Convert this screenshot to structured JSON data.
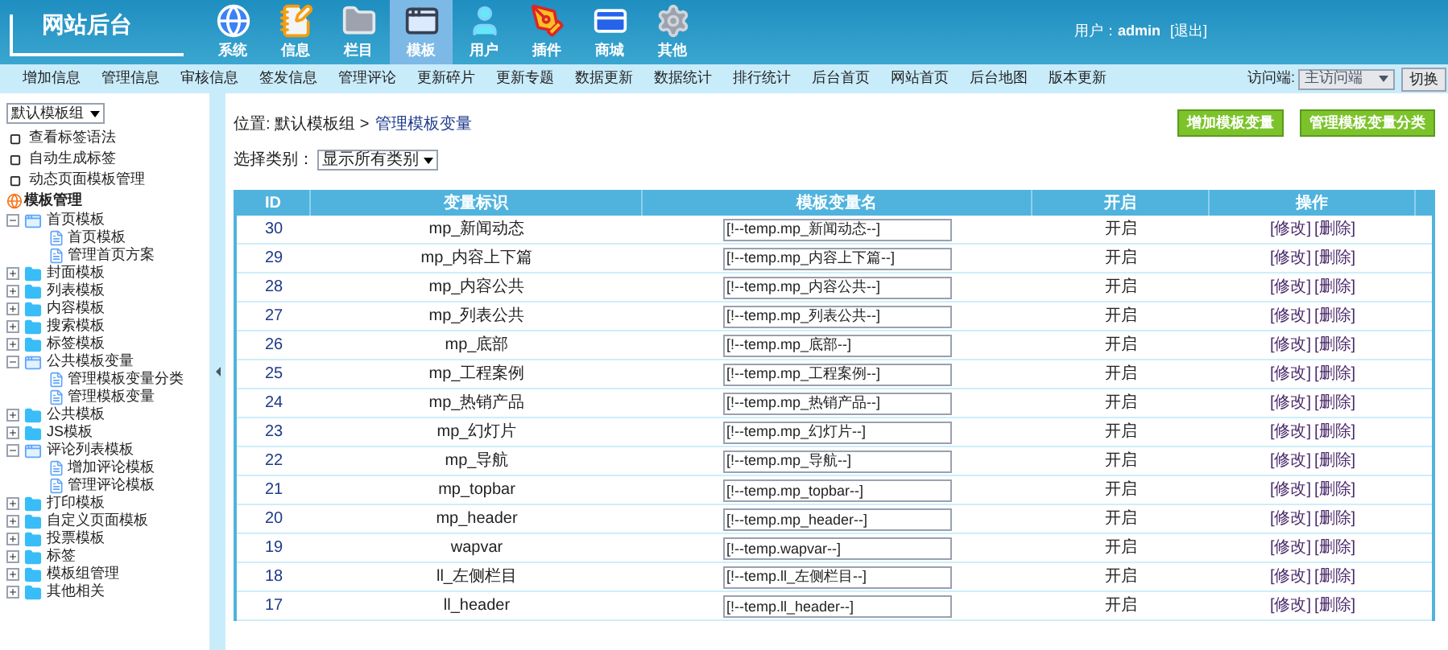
{
  "header": {
    "logo_text": "网站后台",
    "modules": [
      {
        "label": "系统",
        "kind": "globe",
        "selected": false
      },
      {
        "label": "信息",
        "kind": "note",
        "selected": false
      },
      {
        "label": "栏目",
        "kind": "folder",
        "selected": false
      },
      {
        "label": "模板",
        "kind": "window",
        "selected": true
      },
      {
        "label": "用户",
        "kind": "user",
        "selected": false
      },
      {
        "label": "插件",
        "kind": "tools",
        "selected": false
      },
      {
        "label": "商城",
        "kind": "card",
        "selected": false
      },
      {
        "label": "其他",
        "kind": "gear",
        "selected": false
      }
    ],
    "user_label": "用户：",
    "user": "admin",
    "logout": "[退出]"
  },
  "nav": {
    "items": [
      "增加信息",
      "管理信息",
      "审核信息",
      "签发信息",
      "管理评论",
      "更新碎片",
      "更新专题",
      "数据更新",
      "数据统计",
      "排行统计",
      "后台首页",
      "网站首页",
      "后台地图",
      "版本更新"
    ],
    "visit_label": "访问端:",
    "visit_select": "主访问端",
    "switch_button": "切换"
  },
  "sidebar": {
    "group_select": "默认模板组",
    "links": [
      "查看标签语法",
      "自动生成标签",
      "动态页面模板管理"
    ],
    "tree_title": "模板管理",
    "tree": [
      {
        "label": "首页模板",
        "expanded": true,
        "children": [
          {
            "label": "首页模板"
          },
          {
            "label": "管理首页方案"
          }
        ]
      },
      {
        "label": "封面模板",
        "expanded": false
      },
      {
        "label": "列表模板",
        "expanded": false
      },
      {
        "label": "内容模板",
        "expanded": false
      },
      {
        "label": "搜索模板",
        "expanded": false
      },
      {
        "label": "标签模板",
        "expanded": false
      },
      {
        "label": "公共模板变量",
        "expanded": true,
        "children": [
          {
            "label": "管理模板变量分类"
          },
          {
            "label": "管理模板变量"
          }
        ]
      },
      {
        "label": "公共模板",
        "expanded": false
      },
      {
        "label": "JS模板",
        "expanded": false
      },
      {
        "label": "评论列表模板",
        "expanded": true,
        "children": [
          {
            "label": "增加评论模板"
          },
          {
            "label": "管理评论模板"
          }
        ]
      },
      {
        "label": "打印模板",
        "expanded": false
      },
      {
        "label": "自定义页面模板",
        "expanded": false
      },
      {
        "label": "投票模板",
        "expanded": false
      },
      {
        "label": "标签",
        "expanded": false
      },
      {
        "label": "模板组管理",
        "expanded": false
      },
      {
        "label": "其他相关",
        "expanded": false
      }
    ]
  },
  "content": {
    "breadcrumb": "位置: 默认模板组 >",
    "breadcrumb_link": "管理模板变量",
    "buttons": [
      "增加模板变量",
      "管理模板变量分类"
    ],
    "filter_label": "选择类别：",
    "filter_select": "显示所有类别",
    "table": {
      "columns": [
        "ID",
        "变量标识",
        "模板变量名",
        "开启",
        "操作"
      ],
      "rows": [
        {
          "id": "30",
          "var": "mp_新闻动态",
          "name": "[!--temp.mp_新闻动态--]",
          "status": "开启",
          "edit": "[修改]",
          "del": "[删除]"
        },
        {
          "id": "29",
          "var": "mp_内容上下篇",
          "name": "[!--temp.mp_内容上下篇--]",
          "status": "开启",
          "edit": "[修改]",
          "del": "[删除]"
        },
        {
          "id": "28",
          "var": "mp_内容公共",
          "name": "[!--temp.mp_内容公共--]",
          "status": "开启",
          "edit": "[修改]",
          "del": "[删除]"
        },
        {
          "id": "27",
          "var": "mp_列表公共",
          "name": "[!--temp.mp_列表公共--]",
          "status": "开启",
          "edit": "[修改]",
          "del": "[删除]"
        },
        {
          "id": "26",
          "var": "mp_底部",
          "name": "[!--temp.mp_底部--]",
          "status": "开启",
          "edit": "[修改]",
          "del": "[删除]"
        },
        {
          "id": "25",
          "var": "mp_工程案例",
          "name": "[!--temp.mp_工程案例--]",
          "status": "开启",
          "edit": "[修改]",
          "del": "[删除]"
        },
        {
          "id": "24",
          "var": "mp_热销产品",
          "name": "[!--temp.mp_热销产品--]",
          "status": "开启",
          "edit": "[修改]",
          "del": "[删除]"
        },
        {
          "id": "23",
          "var": "mp_幻灯片",
          "name": "[!--temp.mp_幻灯片--]",
          "status": "开启",
          "edit": "[修改]",
          "del": "[删除]"
        },
        {
          "id": "22",
          "var": "mp_导航",
          "name": "[!--temp.mp_导航--]",
          "status": "开启",
          "edit": "[修改]",
          "del": "[删除]"
        },
        {
          "id": "21",
          "var": "mp_topbar",
          "name": "[!--temp.mp_topbar--]",
          "status": "开启",
          "edit": "[修改]",
          "del": "[删除]"
        },
        {
          "id": "20",
          "var": "mp_header",
          "name": "[!--temp.mp_header--]",
          "status": "开启",
          "edit": "[修改]",
          "del": "[删除]"
        },
        {
          "id": "19",
          "var": "wapvar",
          "name": "[!--temp.wapvar--]",
          "status": "开启",
          "edit": "[修改]",
          "del": "[删除]"
        },
        {
          "id": "18",
          "var": "ll_左侧栏目",
          "name": "[!--temp.ll_左侧栏目--]",
          "status": "开启",
          "edit": "[修改]",
          "del": "[删除]"
        },
        {
          "id": "17",
          "var": "ll_header",
          "name": "[!--temp.ll_header--]",
          "status": "开启",
          "edit": "[修改]",
          "del": "[删除]"
        }
      ]
    }
  }
}
